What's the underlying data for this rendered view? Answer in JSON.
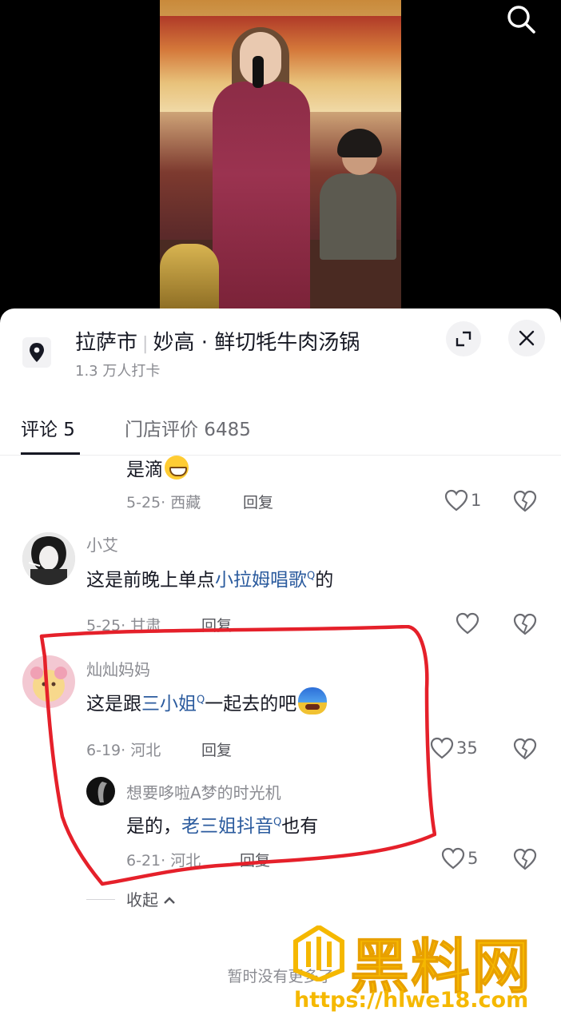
{
  "location": {
    "city": "拉萨市",
    "shop": "妙高 · 鲜切牦牛肉汤锅",
    "checkins": "1.3 万人打卡"
  },
  "tabs": {
    "comments": "评论 5",
    "reviews": "门店评价 6485"
  },
  "comments": [
    {
      "text": "是滴",
      "emoji": "grin-emoji",
      "meta": "5-25· 西藏",
      "reply": "回复",
      "likes": "1"
    },
    {
      "user": "小艾",
      "text_before": "这是前晚上单点",
      "link": "小拉姆唱歌",
      "text_after": "的",
      "meta": "5-25· 甘肃",
      "reply": "回复",
      "likes": ""
    },
    {
      "user": "灿灿妈妈",
      "text_before": "这是跟",
      "link": "三小姐",
      "text_after": "一起去的吧",
      "emoji": "cold-face-emoji",
      "meta": "6-19· 河北",
      "reply": "回复",
      "likes": "35",
      "replies": [
        {
          "user": "想要哆啦A梦的时光机",
          "text_before": "是的，",
          "link": "老三姐抖音",
          "text_after": "也有",
          "meta": "6-21· 河北",
          "reply": "回复",
          "likes": "5"
        }
      ]
    }
  ],
  "collapse": "收起",
  "no_more": "暂时没有更多了",
  "watermark": {
    "logo_text": "黑料网",
    "url": "https://hlwe18.com"
  },
  "colors": {
    "link": "#2b5b9e",
    "annotation": "#e5202a",
    "watermark": "#f5b800"
  }
}
